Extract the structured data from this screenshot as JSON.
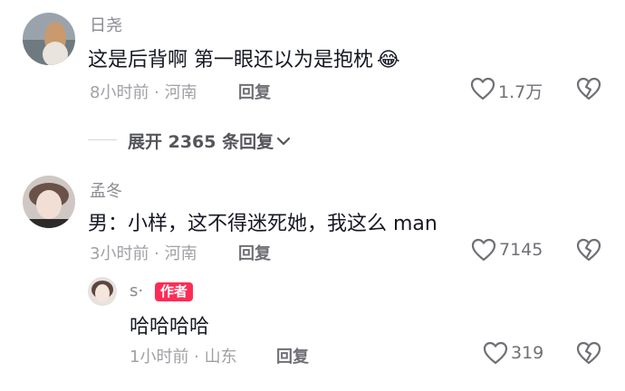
{
  "comments": [
    {
      "author": "日尧",
      "text": "这是后背啊 第一眼还以为是抱枕",
      "emoji": "😂",
      "meta": "8小时前 · 河南",
      "reply_label": "回复",
      "likes": "1.7万"
    },
    {
      "author": "孟冬",
      "text": "男：小样，这不得迷死她，我这么 man",
      "meta": "3小时前 · 河南",
      "reply_label": "回复",
      "likes": "7145"
    }
  ],
  "expand_replies": {
    "label": "展开 2365 条回复"
  },
  "sub_reply": {
    "author": "s·",
    "author_badge": "作者",
    "text": "哈哈哈哈",
    "meta": "1小时前 · 山东",
    "reply_label": "回复",
    "likes": "319"
  },
  "colors": {
    "badge": "#fe2c55",
    "meta": "#a0a1a6",
    "text": "#161823"
  },
  "icons": [
    "heart-outline-icon",
    "dislike-heart-icon",
    "chevron-down-icon"
  ]
}
